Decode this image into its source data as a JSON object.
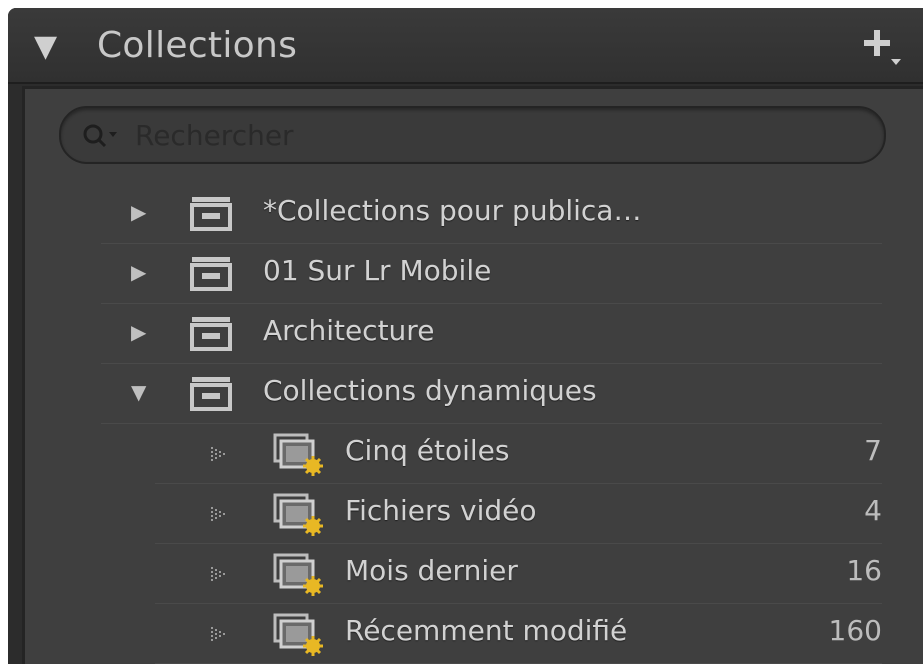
{
  "panel": {
    "title": "Collections",
    "expand_icon": "triangle-down-icon",
    "add_icon": "plus-dropdown-icon"
  },
  "search": {
    "placeholder": "Rechercher",
    "value": ""
  },
  "collection_sets": [
    {
      "label": "*Collections pour publica…",
      "expanded": false
    },
    {
      "label": "01 Sur Lr Mobile",
      "expanded": false
    },
    {
      "label": "Architecture",
      "expanded": false
    },
    {
      "label": "Collections dynamiques",
      "expanded": true
    }
  ],
  "smart_collections": [
    {
      "label": "Cinq étoiles",
      "count": "7"
    },
    {
      "label": "Fichiers vidéo",
      "count": "4"
    },
    {
      "label": "Mois dernier",
      "count": "16"
    },
    {
      "label": "Récemment modifié",
      "count": "160"
    }
  ],
  "colors": {
    "header_bg": "#333333",
    "body_bg": "#3f3f3f",
    "text": "#d2d2d2",
    "gear_accent": "#e8b824"
  }
}
